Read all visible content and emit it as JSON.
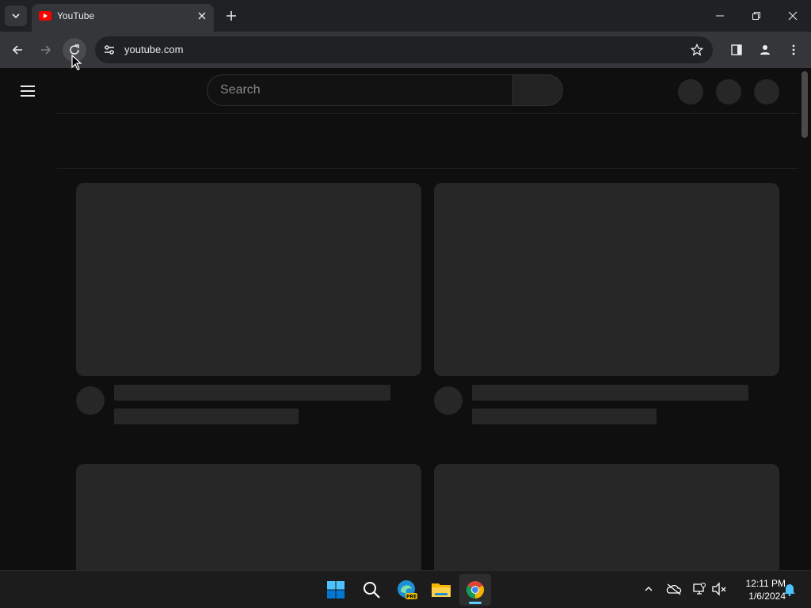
{
  "browser": {
    "tab": {
      "title": "YouTube",
      "favicon": "youtube-icon"
    },
    "address_bar": {
      "url": "youtube.com"
    },
    "icons": {
      "tab_search": "chevron-down-icon",
      "new_tab": "plus-icon",
      "minimize": "minimize-icon",
      "restore": "restore-icon",
      "close": "close-icon",
      "back": "arrow-left-icon",
      "forward": "arrow-right-icon",
      "reload": "reload-icon",
      "site_info": "tune-icon",
      "bookmark": "star-icon",
      "side_panel": "side-panel-icon",
      "profile": "person-icon",
      "menu": "kebab-icon"
    }
  },
  "youtube": {
    "search": {
      "placeholder": "Search"
    },
    "state": "loading-skeleton"
  },
  "taskbar": {
    "apps": [
      "windows-start-icon",
      "search-icon",
      "edge-preview-icon",
      "file-explorer-icon",
      "chrome-icon"
    ],
    "edge_badge": "PRE",
    "clock": {
      "time": "12:11 PM",
      "date": "1/6/2024"
    }
  },
  "colors": {
    "page_bg": "#0f0f0f",
    "skeleton": "#272727",
    "toolbar": "#35363a",
    "tabstrip": "#202124",
    "youtube_red": "#ff0000",
    "taskbar_accent": "#60cdff"
  }
}
